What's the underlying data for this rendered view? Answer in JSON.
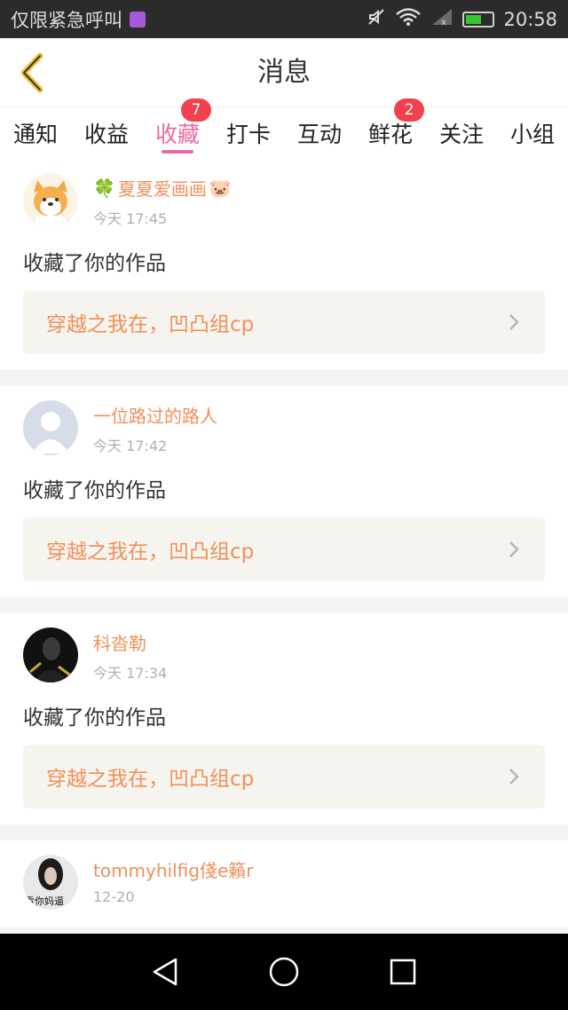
{
  "status_bar": {
    "left_text": "仅限紧急呼叫",
    "time": "20:58",
    "battery_level": 0.6,
    "icons": [
      "sim-app-icon",
      "mute-icon",
      "wifi-icon",
      "signal-icon",
      "battery-icon"
    ]
  },
  "header": {
    "title": "消息",
    "back_icon": "chevron-left-icon"
  },
  "tabs": [
    {
      "label": "通知",
      "badge": ""
    },
    {
      "label": "收益",
      "badge": ""
    },
    {
      "label": "收藏",
      "badge": "7",
      "active": true
    },
    {
      "label": "打卡",
      "badge": ""
    },
    {
      "label": "互动",
      "badge": ""
    },
    {
      "label": "鲜花",
      "badge": "2"
    },
    {
      "label": "关注",
      "badge": ""
    },
    {
      "label": "小组",
      "badge": ""
    }
  ],
  "messages": [
    {
      "username": "夏夏爱画画",
      "username_prefix_emoji": "🍀",
      "username_suffix_emoji": "🐷",
      "time": "今天 17:45",
      "action": "收藏了你的作品",
      "work_title": "穿越之我在，凹凸组cp"
    },
    {
      "username": "一位路过的路人",
      "time": "今天 17:42",
      "action": "收藏了你的作品",
      "work_title": "穿越之我在，凹凸组cp"
    },
    {
      "username": "科沓勒",
      "time": "今天 17:34",
      "action": "收藏了你的作品",
      "work_title": "穿越之我在，凹凸组cp"
    },
    {
      "username": "tommyhilfig俴e籟r",
      "avatar_caption": "看你妈逼",
      "time": "12-20",
      "action": "",
      "work_title": ""
    }
  ],
  "colors": {
    "accent_pink": "#e86aa0",
    "username_orange": "#f0905b",
    "badge_red": "#f0414d",
    "work_box_bg": "#f6f4ee"
  },
  "nav_bar": {
    "icons": [
      "back-triangle-icon",
      "home-circle-icon",
      "recents-square-icon"
    ]
  }
}
